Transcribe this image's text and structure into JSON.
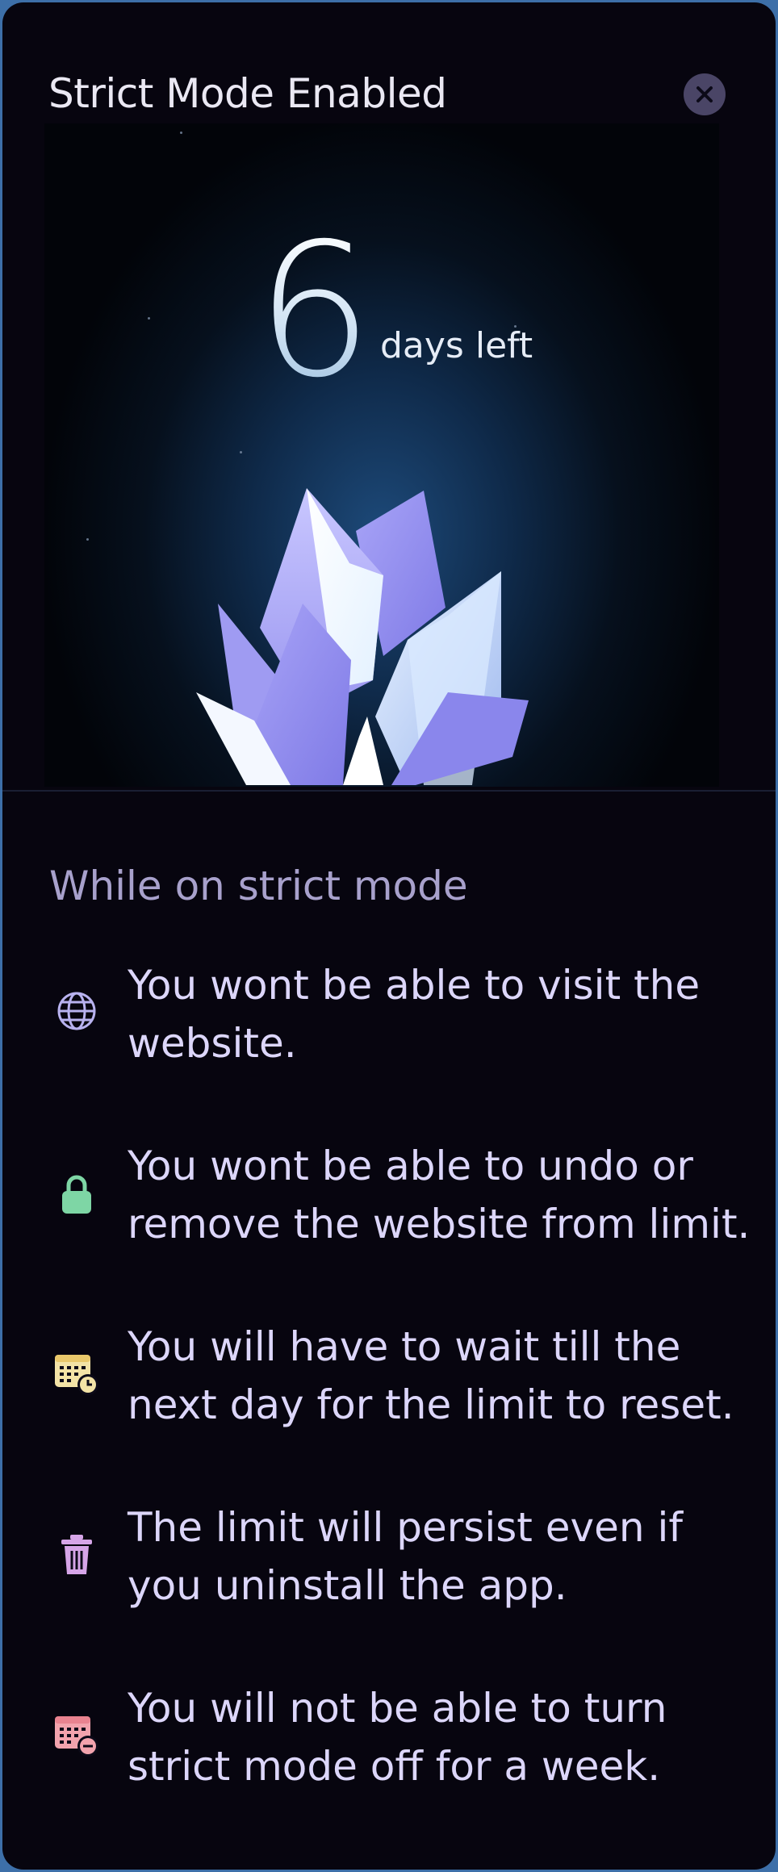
{
  "modal": {
    "title": "Strict Mode Enabled",
    "close_icon": "close-icon"
  },
  "countdown": {
    "value": "6",
    "label": "days left"
  },
  "info": {
    "heading": "While on strict mode",
    "items": [
      {
        "icon": "globe-icon",
        "text": "You wont be able to visit the website.",
        "color": "#b8b2ef"
      },
      {
        "icon": "lock-icon",
        "text": "You wont be able to undo or remove the website from limit.",
        "color": "#7ed6a5"
      },
      {
        "icon": "calendar-clock-icon",
        "text": "You will have to wait till the next day for the limit to reset.",
        "color": "#f3e3a6"
      },
      {
        "icon": "trash-icon",
        "text": "The limit will persist even if you uninstall the app.",
        "color": "#d6a5e8"
      },
      {
        "icon": "calendar-minus-icon",
        "text": "You will not be able to turn strict mode off for a week.",
        "color": "#f2a3ad"
      }
    ]
  },
  "colors": {
    "background": "#07050f",
    "text_primary": "#dcd6fa",
    "text_secondary": "#a8a1cc",
    "frame": "#3d6fa8"
  }
}
